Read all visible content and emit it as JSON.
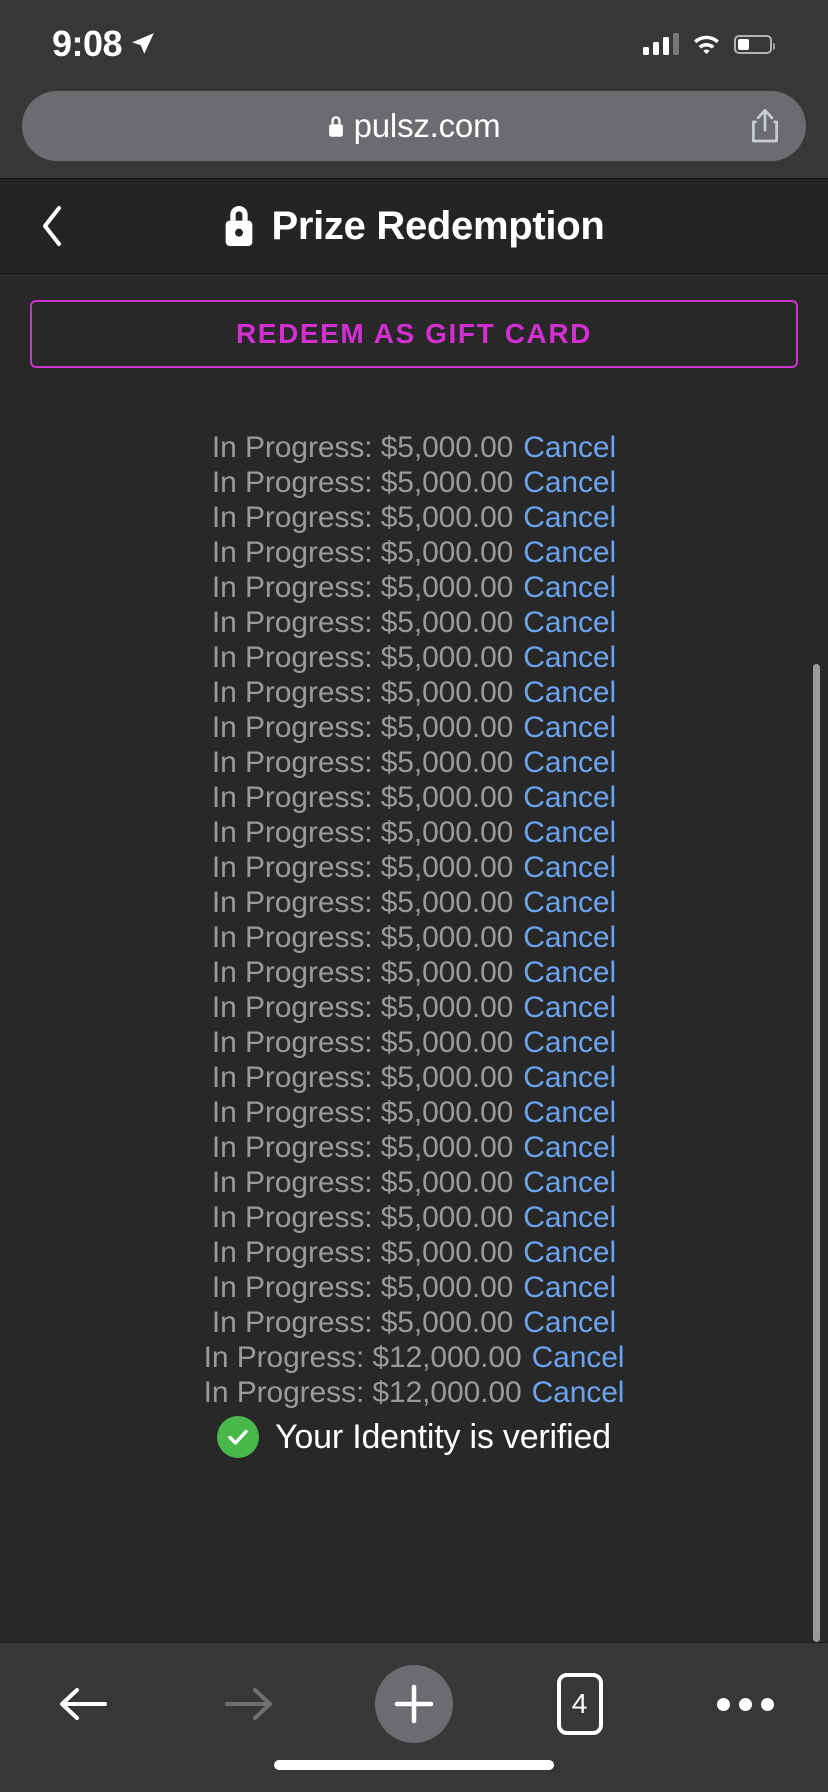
{
  "status_bar": {
    "time": "9:08",
    "location_icon": "location-arrow-icon",
    "signal_icon": "cellular-signal-icon",
    "wifi_icon": "wifi-icon",
    "battery_icon": "battery-low-icon",
    "battery_level_pct": 36
  },
  "browser": {
    "url": "pulsz.com",
    "lock_icon": "lock-icon",
    "share_icon": "share-icon"
  },
  "page_header": {
    "back_label": "‹",
    "lock_icon": "lock-icon",
    "title": "Prize Redemption"
  },
  "main": {
    "redeem_button_label": "REDEEM AS GIFT CARD",
    "accent_color": "#d22ed2",
    "link_color": "#6aa4f0",
    "muted_text_color": "#9a9a9a",
    "cancel_label": "Cancel",
    "redemptions": [
      {
        "status": "In Progress:",
        "amount": "$5,000.00"
      },
      {
        "status": "In Progress:",
        "amount": "$5,000.00"
      },
      {
        "status": "In Progress:",
        "amount": "$5,000.00"
      },
      {
        "status": "In Progress:",
        "amount": "$5,000.00"
      },
      {
        "status": "In Progress:",
        "amount": "$5,000.00"
      },
      {
        "status": "In Progress:",
        "amount": "$5,000.00"
      },
      {
        "status": "In Progress:",
        "amount": "$5,000.00"
      },
      {
        "status": "In Progress:",
        "amount": "$5,000.00"
      },
      {
        "status": "In Progress:",
        "amount": "$5,000.00"
      },
      {
        "status": "In Progress:",
        "amount": "$5,000.00"
      },
      {
        "status": "In Progress:",
        "amount": "$5,000.00"
      },
      {
        "status": "In Progress:",
        "amount": "$5,000.00"
      },
      {
        "status": "In Progress:",
        "amount": "$5,000.00"
      },
      {
        "status": "In Progress:",
        "amount": "$5,000.00"
      },
      {
        "status": "In Progress:",
        "amount": "$5,000.00"
      },
      {
        "status": "In Progress:",
        "amount": "$5,000.00"
      },
      {
        "status": "In Progress:",
        "amount": "$5,000.00"
      },
      {
        "status": "In Progress:",
        "amount": "$5,000.00"
      },
      {
        "status": "In Progress:",
        "amount": "$5,000.00"
      },
      {
        "status": "In Progress:",
        "amount": "$5,000.00"
      },
      {
        "status": "In Progress:",
        "amount": "$5,000.00"
      },
      {
        "status": "In Progress:",
        "amount": "$5,000.00"
      },
      {
        "status": "In Progress:",
        "amount": "$5,000.00"
      },
      {
        "status": "In Progress:",
        "amount": "$5,000.00"
      },
      {
        "status": "In Progress:",
        "amount": "$5,000.00"
      },
      {
        "status": "In Progress:",
        "amount": "$5,000.00"
      },
      {
        "status": "In Progress:",
        "amount": "$12,000.00"
      },
      {
        "status": "In Progress:",
        "amount": "$12,000.00"
      }
    ],
    "identity": {
      "check_icon": "check-circle-icon",
      "check_color": "#49b84b",
      "text": "Your Identity is verified"
    }
  },
  "toolbar": {
    "back_icon": "arrow-left-icon",
    "forward_icon": "arrow-right-icon",
    "new_tab_icon": "plus-icon",
    "tabs_count": "4",
    "more_icon": "ellipsis-icon"
  }
}
